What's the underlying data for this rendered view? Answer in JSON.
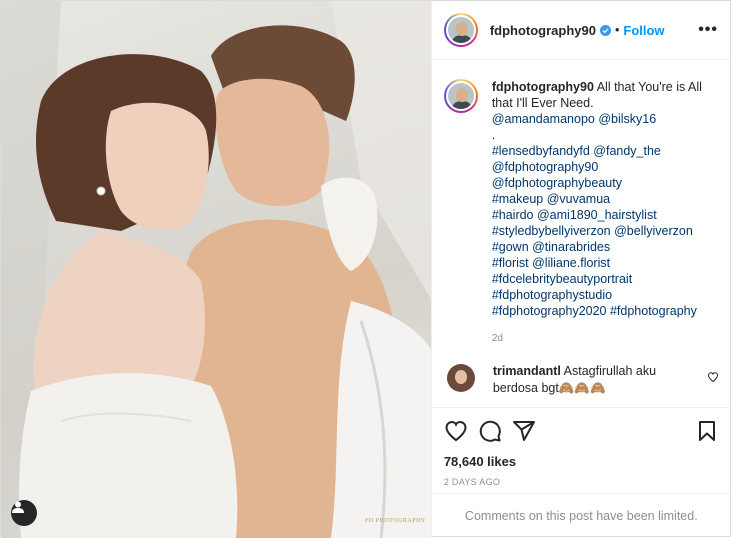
{
  "post": {
    "username": "fdphotography90",
    "follow_label": "Follow",
    "separator": "•",
    "more_label": "•••",
    "caption": {
      "username": "fdphotography90",
      "text": "All that You're is All that I'll Ever Need.",
      "mentions": "@amandamanopo @bilsky16",
      "dot": ".",
      "tag_lines": [
        "#lensedbyfandyfd @fandy_the",
        "@fdphotography90",
        "@fdphotographybeauty",
        "#makeup @vuvamua",
        "#hairdo @ami1890_hairstylist",
        "#styledbybellyiverzon @bellyiverzon",
        "#gown @tinarabrides",
        "#florist @liliane.florist",
        "#fdcelebritybeautyportrait",
        "#fdphotographystudio",
        "#fdphotography2020 #fdphotography"
      ],
      "age": "2d"
    },
    "comment": {
      "username": "trimandantl",
      "text": "Astagfirullah aku berdosa bgt🙈🙈🙈"
    },
    "likes": "78,640 likes",
    "date": "2 DAYS AGO",
    "limited_text": "Comments on this post have been limited.",
    "watermark": "FD PHOTOGRAPHY",
    "colors": {
      "accent": "#0095f6",
      "link": "#00376b",
      "muted": "#8e8e8e"
    },
    "icons": [
      "verified-icon",
      "heart-icon",
      "comment-icon",
      "share-icon",
      "bookmark-icon",
      "user-tag-icon"
    ]
  }
}
